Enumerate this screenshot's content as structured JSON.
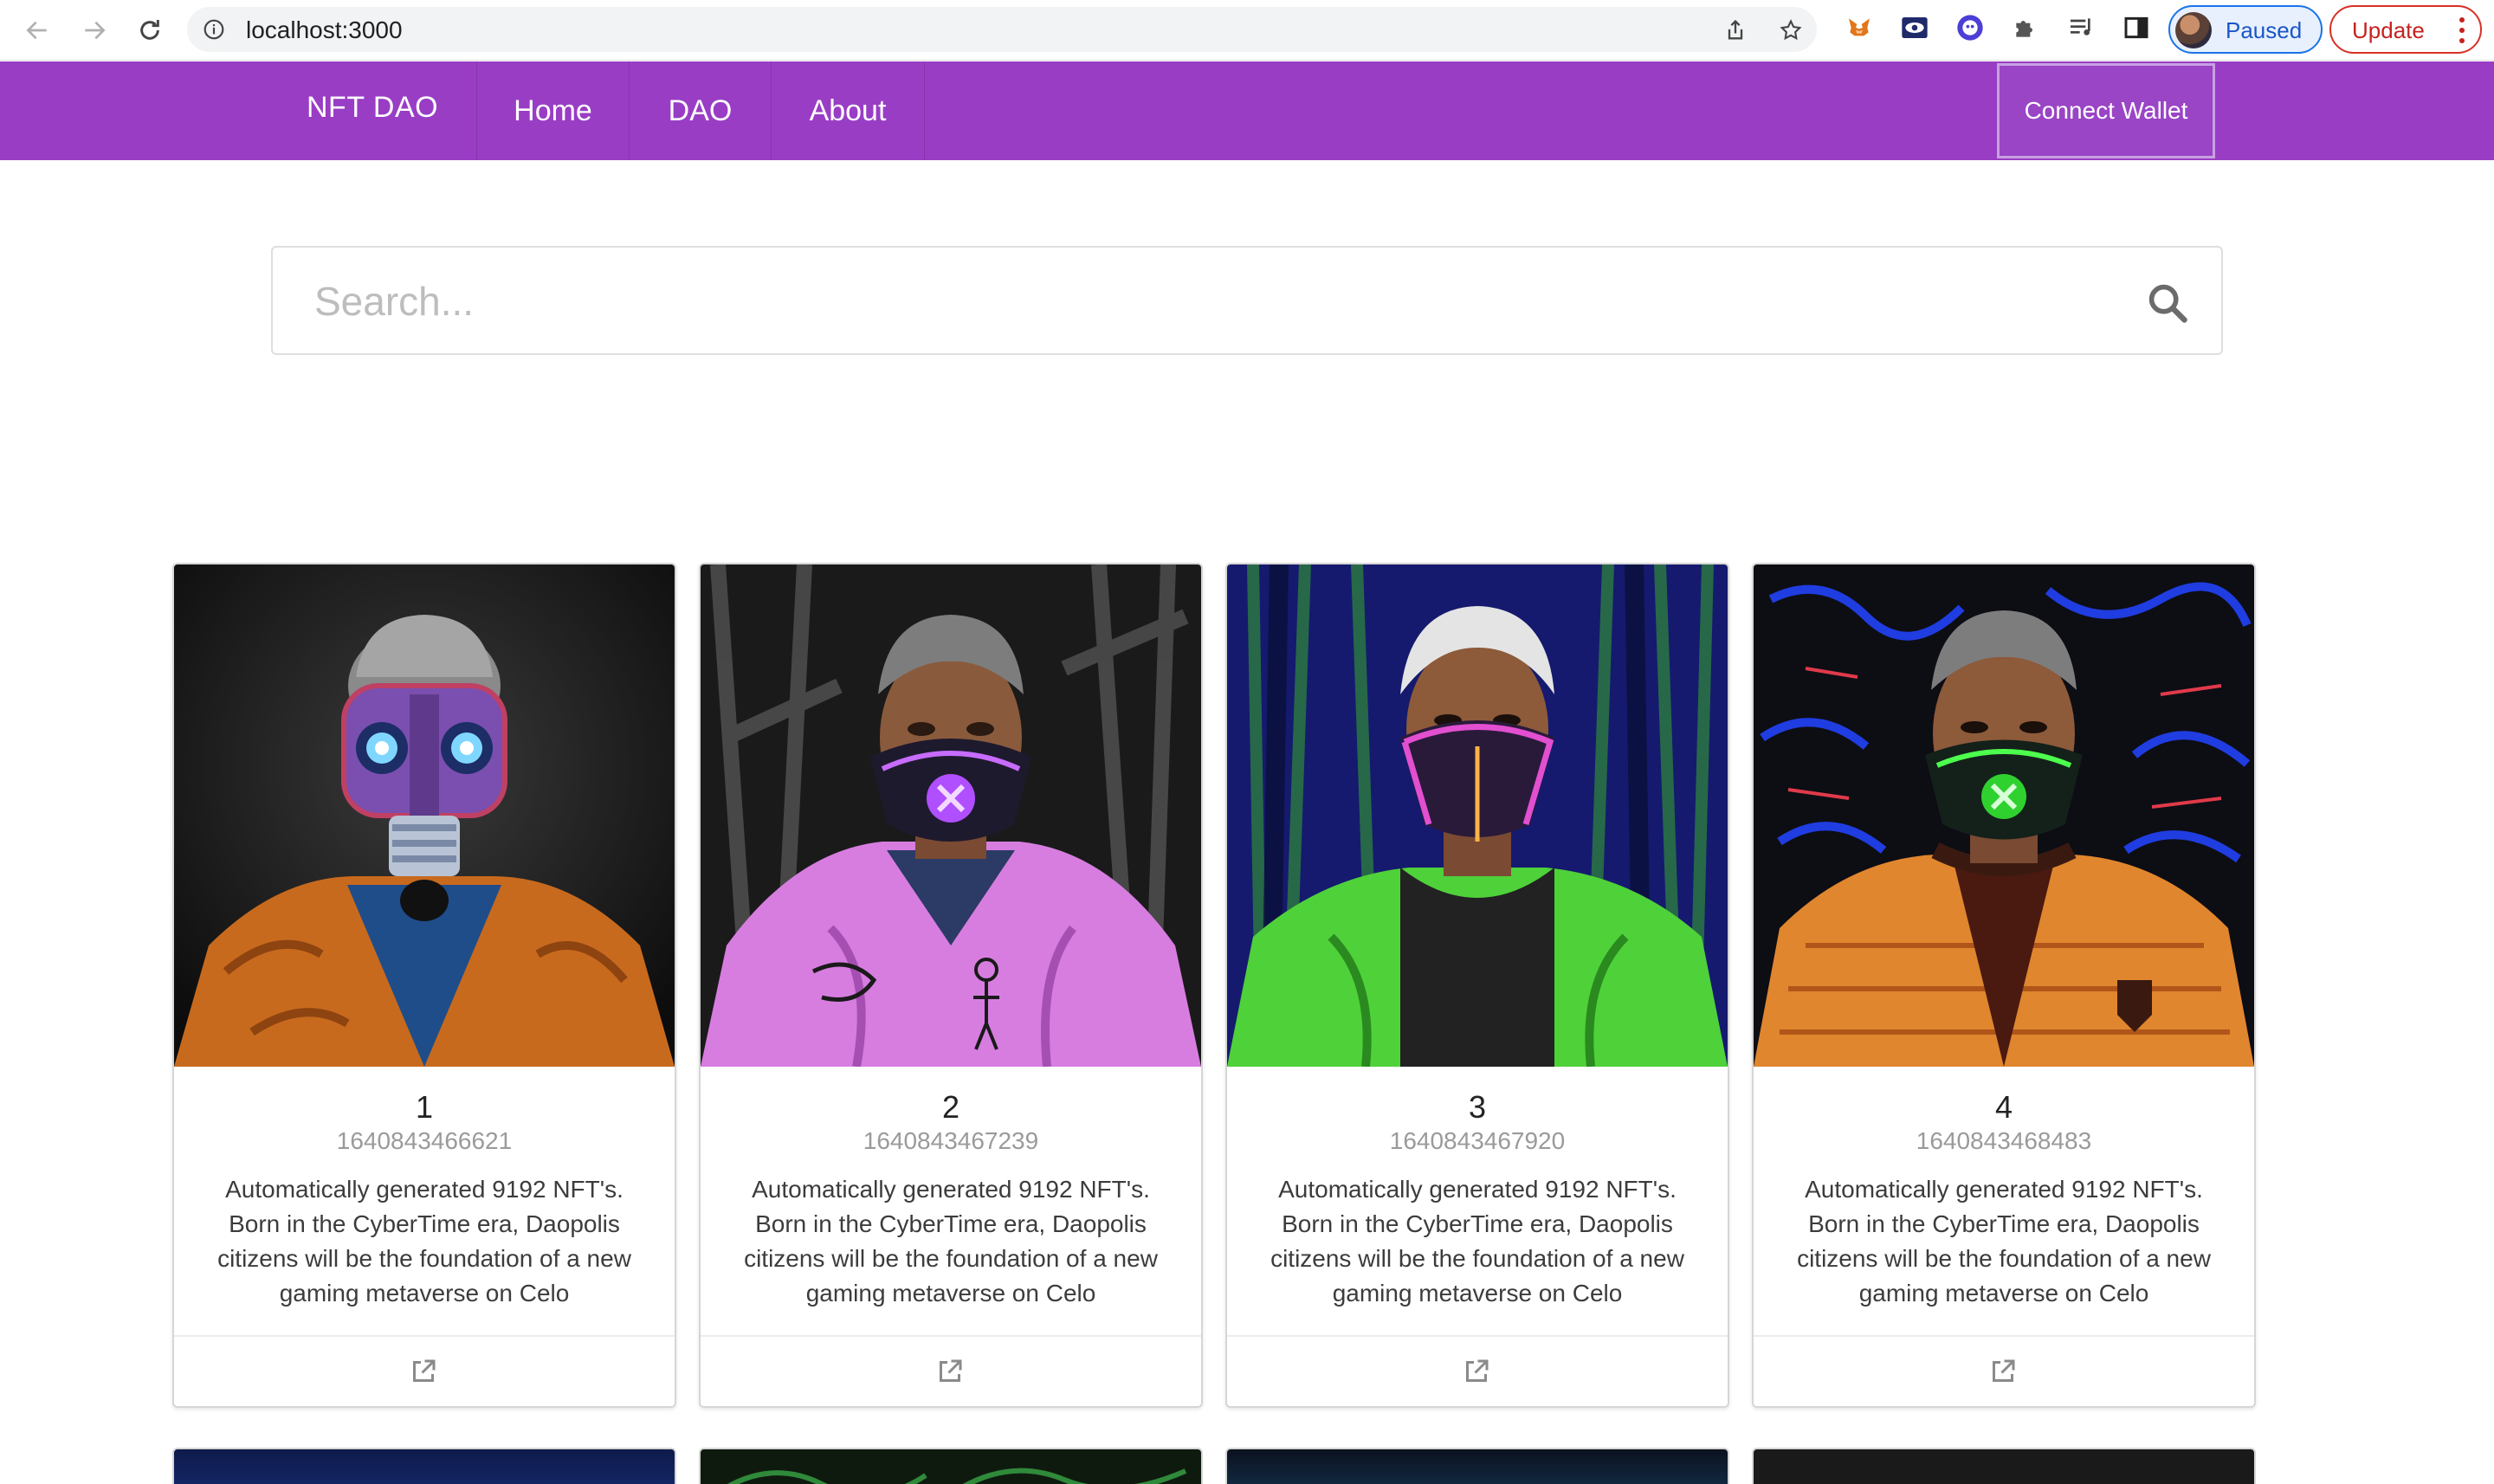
{
  "browser": {
    "url": "localhost:3000",
    "profile_label": "Paused",
    "update_label": "Update",
    "extensions": [
      "metamask-fox-icon",
      "eye-extension-icon",
      "ghost-extension-icon",
      "puzzle-icon",
      "media-queue-icon",
      "side-panel-icon"
    ]
  },
  "navbar": {
    "brand": "NFT DAO",
    "links": [
      {
        "label": "Home"
      },
      {
        "label": "DAO"
      },
      {
        "label": "About"
      }
    ],
    "connect_label": "Connect Wallet",
    "color": "#993dc5"
  },
  "search": {
    "placeholder": "Search..."
  },
  "cards": [
    {
      "number": "1",
      "timestamp": "1640843466621",
      "description": "Automatically generated 9192 NFT's. Born in the CyberTime era, Daopolis citizens will be the foundation of a new gaming metaverse on Celo"
    },
    {
      "number": "2",
      "timestamp": "1640843467239",
      "description": "Automatically generated 9192 NFT's. Born in the CyberTime era, Daopolis citizens will be the foundation of a new gaming metaverse on Celo"
    },
    {
      "number": "3",
      "timestamp": "1640843467920",
      "description": "Automatically generated 9192 NFT's. Born in the CyberTime era, Daopolis citizens will be the foundation of a new gaming metaverse on Celo"
    },
    {
      "number": "4",
      "timestamp": "1640843468483",
      "description": "Automatically generated 9192 NFT's. Born in the CyberTime era, Daopolis citizens will be the foundation of a new gaming metaverse on Celo"
    }
  ]
}
